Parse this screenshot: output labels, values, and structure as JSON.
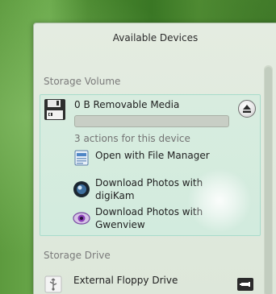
{
  "window": {
    "title": "Available Devices"
  },
  "sections": {
    "storage_volume": "Storage Volume",
    "storage_drive": "Storage Drive"
  },
  "volume": {
    "name": "0 B Removable Media",
    "usage_fraction": 0.0,
    "actions_count_label": "3 actions for this device",
    "actions": [
      {
        "label": "Open with File Manager",
        "icon": "file-manager-icon"
      },
      {
        "label": "Download Photos with\ndigiKam",
        "icon": "digikam-icon"
      },
      {
        "label": "Download Photos with\nGwenview",
        "icon": "gwenview-icon"
      }
    ]
  },
  "drive": {
    "name": "External Floppy Drive"
  },
  "icons": {
    "volume": "floppy-disk-icon",
    "eject": "eject-icon",
    "drive": "usb-icon",
    "unmount": "unmount-icon"
  },
  "colors": {
    "accent_border": "#a7dccb",
    "panel_bg": "#e4ece1",
    "section_text": "#7b7b7b"
  }
}
